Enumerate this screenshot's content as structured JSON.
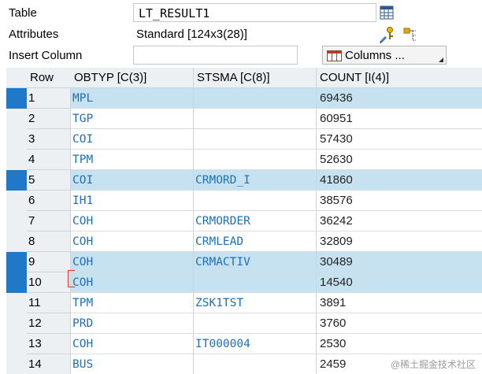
{
  "form": {
    "table_label": "Table",
    "table_value": "LT_RESULT1",
    "attributes_label": "Attributes",
    "attributes_value": "Standard [124x3(28)]",
    "insert_label": "Insert Column",
    "insert_value": "",
    "columns_button": "Columns ..."
  },
  "table": {
    "headers": [
      "Row",
      "OBTYP [C(3)]",
      "STSMA [C(8)]",
      "COUNT [I(4)]"
    ],
    "rows": [
      {
        "row": "1",
        "obtyp": "MPL",
        "stsma": "",
        "count": "69436",
        "highlight": true,
        "selected": true
      },
      {
        "row": "2",
        "obtyp": "TGP",
        "stsma": "",
        "count": "60951",
        "highlight": false,
        "selected": false
      },
      {
        "row": "3",
        "obtyp": "COI",
        "stsma": "",
        "count": "57430",
        "highlight": false,
        "selected": false
      },
      {
        "row": "4",
        "obtyp": "TPM",
        "stsma": "",
        "count": "52630",
        "highlight": false,
        "selected": false
      },
      {
        "row": "5",
        "obtyp": "COI",
        "stsma": "CRMORD_I",
        "count": "41860",
        "highlight": true,
        "selected": true
      },
      {
        "row": "6",
        "obtyp": "IH1",
        "stsma": "",
        "count": "38576",
        "highlight": false,
        "selected": false
      },
      {
        "row": "7",
        "obtyp": "COH",
        "stsma": "CRMORDER",
        "count": "36242",
        "highlight": false,
        "selected": false
      },
      {
        "row": "8",
        "obtyp": "COH",
        "stsma": "CRMLEAD",
        "count": "32809",
        "highlight": false,
        "selected": false
      },
      {
        "row": "9",
        "obtyp": "COH",
        "stsma": "CRMACTIV",
        "count": "30489",
        "highlight": true,
        "selected": true
      },
      {
        "row": "10",
        "obtyp": "COH",
        "stsma": "",
        "count": "14540",
        "highlight": true,
        "selected": true
      },
      {
        "row": "11",
        "obtyp": "TPM",
        "stsma": "ZSK1TST",
        "count": "3891",
        "highlight": false,
        "selected": false
      },
      {
        "row": "12",
        "obtyp": "PRD",
        "stsma": "",
        "count": "3760",
        "highlight": false,
        "selected": false
      },
      {
        "row": "13",
        "obtyp": "COH",
        "stsma": "IT000004",
        "count": "2530",
        "highlight": false,
        "selected": false
      },
      {
        "row": "14",
        "obtyp": "BUS",
        "stsma": "",
        "count": "2459",
        "highlight": false,
        "selected": false
      }
    ]
  },
  "icons": {
    "table_view": "table-grid-icon",
    "attributes_edit": "key-pencil-icon",
    "attributes_structure": "hierarchy-icon",
    "columns": "columns-grid-icon"
  },
  "watermark": "@稀土掘金技术社区"
}
